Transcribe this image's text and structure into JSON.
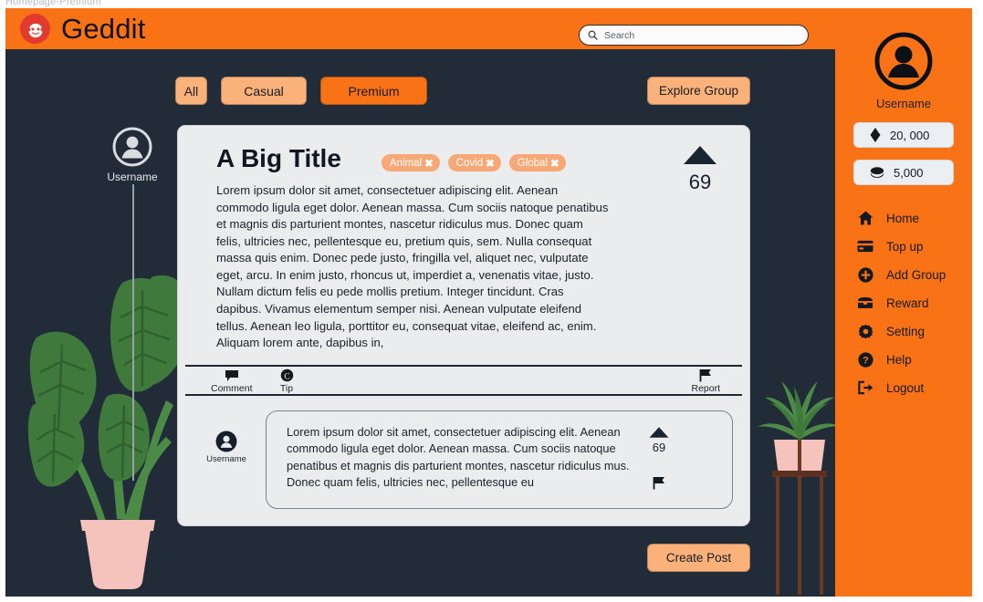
{
  "frame": {
    "caption": "Homepage-Premium"
  },
  "brand": {
    "name": "Geddit",
    "logo_icon": "snoo-logo-icon",
    "accent": "#f97316",
    "pill_light": "#fbb27a",
    "bg_dark": "#222b38",
    "card_bg": "#ebecee"
  },
  "search": {
    "placeholder": "Search",
    "value": "",
    "icon": "search-icon"
  },
  "filters": [
    {
      "label": "All",
      "active": false
    },
    {
      "label": "Casual",
      "active": false
    },
    {
      "label": "Premium",
      "active": true
    }
  ],
  "buttons": {
    "explore_group": "Explore Group",
    "create_post": "Create Post"
  },
  "left_user": {
    "name": "Username",
    "avatar_icon": "user-avatar-icon"
  },
  "post": {
    "title": "A Big Title",
    "tags": [
      {
        "label": "Animal",
        "remove": "✖"
      },
      {
        "label": "Covid",
        "remove": "✖"
      },
      {
        "label": "Global",
        "remove": "✖"
      }
    ],
    "vote_count": "69",
    "upvote_icon": "upvote-triangle-icon",
    "body": "Lorem ipsum dolor sit amet, consectetuer adipiscing elit. Aenean commodo ligula eget dolor. Aenean massa. Cum sociis natoque penatibus et magnis dis parturient montes, nascetur ridiculus mus. Donec quam felis, ultricies nec, pellentesque eu, pretium quis, sem. Nulla consequat massa quis enim. Donec pede justo, fringilla vel, aliquet nec, vulputate eget, arcu. In enim justo, rhoncus ut, imperdiet a, venenatis vitae, justo. Nullam dictum felis eu pede mollis pretium. Integer tincidunt. Cras dapibus. Vivamus elementum semper nisi. Aenean vulputate eleifend tellus. Aenean leo ligula, porttitor eu, consequat vitae, eleifend ac, enim. Aliquam lorem ante, dapibus in,",
    "actions": [
      {
        "label": "Comment",
        "icon": "comment-bubble-icon"
      },
      {
        "label": "Tip",
        "icon": "copyright-coin-icon"
      },
      {
        "label": "Report",
        "icon": "flag-icon"
      }
    ]
  },
  "comment": {
    "username": "Username",
    "avatar_icon": "user-avatar-icon",
    "text": "Lorem ipsum dolor sit amet, consectetuer adipiscing elit. Aenean commodo ligula eget dolor. Aenean massa. Cum sociis natoque penatibus et magnis dis parturient montes, nascetur ridiculus mus. Donec quam felis, ultricies nec, pellentesque eu",
    "vote_count": "69",
    "upvote_icon": "upvote-triangle-icon",
    "report_icon": "flag-icon"
  },
  "sidebar": {
    "username": "Username",
    "avatar_icon": "user-avatar-icon",
    "balances": [
      {
        "icon": "gem-icon",
        "value": "20, 000"
      },
      {
        "icon": "coin-stack-icon",
        "value": "5,000"
      }
    ],
    "menu": [
      {
        "label": "Home",
        "icon": "home-icon"
      },
      {
        "label": "Top up",
        "icon": "credit-card-icon"
      },
      {
        "label": "Add Group",
        "icon": "plus-circle-icon"
      },
      {
        "label": "Reward",
        "icon": "treasure-chest-icon"
      },
      {
        "label": "Setting",
        "icon": "gear-icon"
      },
      {
        "label": "Help",
        "icon": "question-circle-icon"
      },
      {
        "label": "Logout",
        "icon": "logout-arrow-icon"
      }
    ]
  },
  "decor": {
    "left_plant": "monstera-plant",
    "right_plant": "potted-plant-stand"
  }
}
